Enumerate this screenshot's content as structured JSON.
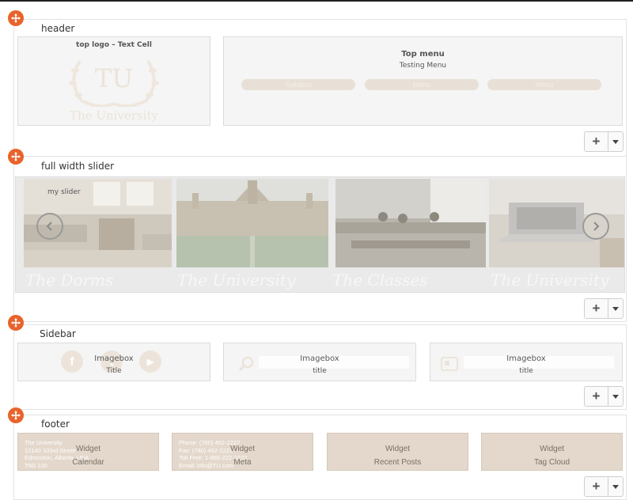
{
  "rows": {
    "header": {
      "label": "header"
    },
    "slider": {
      "label": "full width slider"
    },
    "sidebar": {
      "label": "Sidebar"
    },
    "footer": {
      "label": "footer"
    }
  },
  "header": {
    "logo_cell_title": "top logo – Text Cell",
    "logo_monogram": "TU",
    "logo_name": "The University",
    "menu_cell_title": "Top menu",
    "menu_cell_subtitle": "Testing Menu",
    "menu_items": [
      "Syllabus",
      "Menu",
      "Menu"
    ]
  },
  "slider": {
    "title": "my slider",
    "captions": [
      "The Dorms",
      "The University",
      "The Classes",
      "The University"
    ]
  },
  "sidebar": {
    "boxes": [
      {
        "label": "Imagebox",
        "title": "Title"
      },
      {
        "label": "Imagebox",
        "title": "title"
      },
      {
        "label": "Imagebox",
        "title": "title"
      }
    ],
    "social_icons": [
      "f",
      "t",
      "▶"
    ]
  },
  "footer": {
    "widgets": [
      {
        "title": "Widget",
        "sub": "Calendar",
        "info": [
          "The University",
          "12140 103rd Street",
          "Edmonton, Alberta, USA",
          "T5G 2J0"
        ]
      },
      {
        "title": "Widget",
        "sub": "Meta",
        "info": [
          "Phone: (780) 452-2222",
          "Fax: (780) 452-2222",
          "Toll Free: 1-866-222-2222",
          "Email: info@TU.com"
        ]
      },
      {
        "title": "Widget",
        "sub": "Recent Posts",
        "info": []
      },
      {
        "title": "Widget",
        "sub": "Tag Cloud",
        "info": []
      }
    ]
  },
  "controls": {
    "add_symbol": "+"
  },
  "colors": {
    "accent": "#e8632b",
    "widget_bg": "#e3d8cb",
    "pill_bg": "#e8e0d6"
  }
}
